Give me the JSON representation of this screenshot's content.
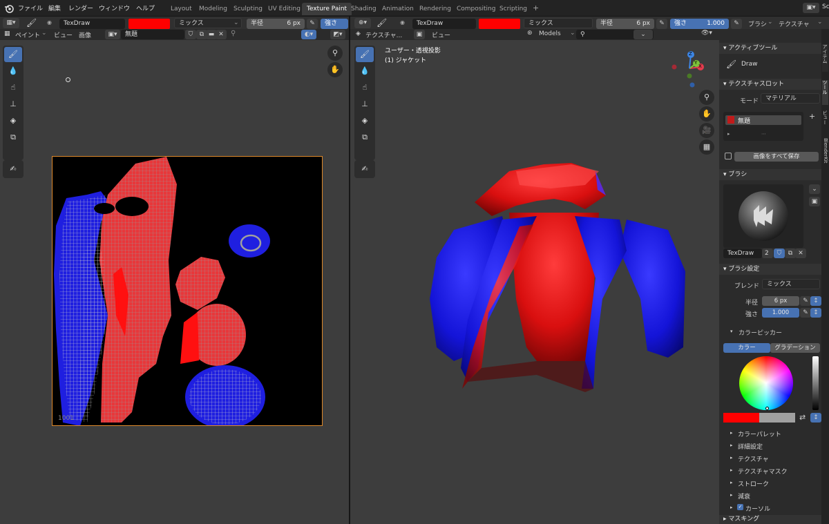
{
  "menubar": {
    "items": [
      "ファイル",
      "編集",
      "レンダー",
      "ウィンドウ",
      "ヘルプ"
    ],
    "workspaces": [
      "Layout",
      "Modeling",
      "Sculpting",
      "UV Editing",
      "Texture Paint",
      "Shading",
      "Animation",
      "Rendering",
      "Compositing",
      "Scripting"
    ],
    "active_workspace": "Texture Paint",
    "add_tab": "+",
    "scene_short": "Sc"
  },
  "left_header": {
    "brush_name": "TexDraw",
    "color": "#ff0000",
    "blend": "ミックス",
    "radius_label": "半径",
    "radius_value": "6 px",
    "strength_label": "強さ",
    "mode": "ペイント",
    "view": "ビュー",
    "image": "画像",
    "image_name": "無題"
  },
  "left_editor": {
    "tile_label": "1001"
  },
  "right_header": {
    "brush_name": "TexDraw",
    "color": "#ff0000",
    "blend": "ミックス",
    "radius_label": "半径",
    "radius_value": "6 px",
    "strength_label": "強さ",
    "strength_value": "1.000",
    "brush_menu": "ブラシ",
    "texture_menu": "テクスチャ",
    "mode": "テクスチャ...",
    "view": "ビュー",
    "collection": "Models"
  },
  "viewport": {
    "projection": "ユーザー・透視投影",
    "object": "(1) ジャケット",
    "gizmo_x": "X",
    "gizmo_y": "Y",
    "gizmo_z": "Z"
  },
  "properties": {
    "active_tool_title": "アクティブツール",
    "active_tool": "Draw",
    "texture_slots_title": "テクスチャスロット",
    "mode_label": "モード",
    "mode_value": "マテリアル",
    "slot_name": "無題",
    "save_all": "画像をすべて保存",
    "brush_title": "ブラシ",
    "brush_name": "TexDraw",
    "brush_users": "2",
    "brush_settings_title": "ブラシ設定",
    "blend_label": "ブレンド",
    "blend_value": "ミックス",
    "radius_label": "半径",
    "radius_value": "6 px",
    "strength_label": "強さ",
    "strength_value": "1.000",
    "color_picker_title": "カラーピッカー",
    "tab_color": "カラー",
    "tab_gradient": "グラデーション",
    "primary_color": "#ff0000",
    "secondary_color": "#a0a0a0",
    "sub_panels": [
      "カラーパレット",
      "詳細設定",
      "テクスチャ",
      "テクスチャマスク",
      "ストローク",
      "減衰",
      "カーソル"
    ],
    "masking_title": "マスキング",
    "side_tabs": [
      "アイテム",
      "ツール",
      "ビュー",
      "BlenderKit"
    ]
  }
}
